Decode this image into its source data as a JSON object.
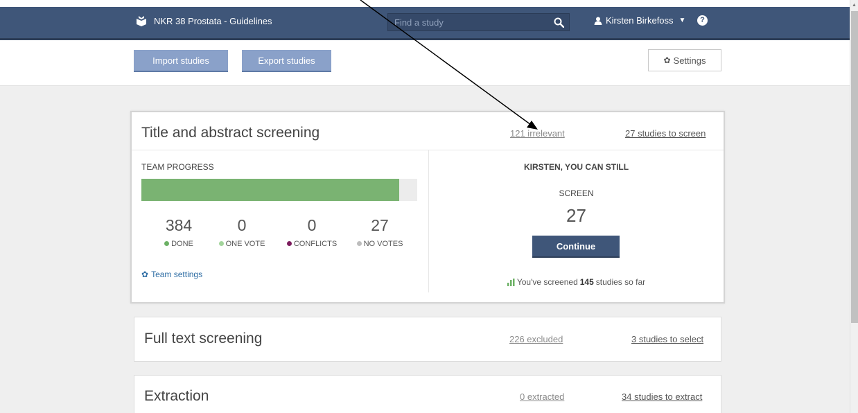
{
  "navbar": {
    "project_title": "NKR 38 Prostata - Guidelines",
    "search_placeholder": "Find a study",
    "user_name": "Kirsten Birkefoss",
    "help_label": "?"
  },
  "toolbar": {
    "import_label": "Import studies",
    "export_label": "Export studies",
    "settings_label": "Settings"
  },
  "title_abstract": {
    "title": "Title and abstract screening",
    "irrelevant_link": "121 irrelevant",
    "to_screen_link": "27 studies to screen",
    "team_progress_label": "TEAM PROGRESS",
    "progress_fraction": 0.934,
    "stats": [
      {
        "value": "384",
        "label": "DONE",
        "color": "#6cb165"
      },
      {
        "value": "0",
        "label": "ONE VOTE",
        "color": "#a3d49c"
      },
      {
        "value": "0",
        "label": "CONFLICTS",
        "color": "#7d1d5e"
      },
      {
        "value": "27",
        "label": "NO VOTES",
        "color": "#bdbdbd"
      }
    ],
    "team_settings_label": "Team settings",
    "right_heading": "KIRSTEN, YOU CAN STILL",
    "right_action": "SCREEN",
    "right_count": "27",
    "continue_label": "Continue",
    "footer_prefix": "You've screened",
    "footer_count": "145",
    "footer_suffix": "studies so far"
  },
  "full_text": {
    "title": "Full text screening",
    "excluded_link": "226 excluded",
    "to_select_link": "3 studies to select"
  },
  "extraction": {
    "title": "Extraction",
    "extracted_link": "0 extracted",
    "to_extract_link": "34 studies to extract"
  },
  "colors": {
    "navbar": "#3f5679",
    "progress_fill": "#7ab372",
    "accent_button": "#8aa1c9"
  }
}
